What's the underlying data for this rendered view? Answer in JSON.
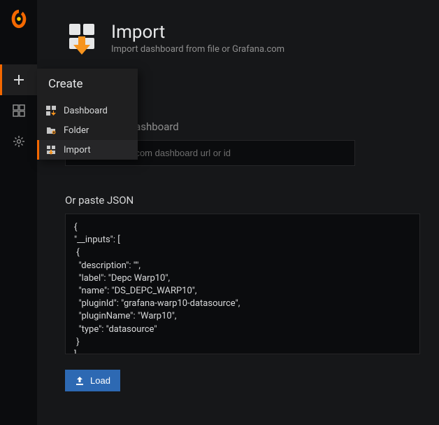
{
  "header": {
    "title": "Import",
    "subtitle": "Import dashboard from file or Grafana.com"
  },
  "flyout": {
    "title": "Create",
    "items": [
      {
        "label": "Dashboard"
      },
      {
        "label": "Folder"
      },
      {
        "label": "Import"
      }
    ]
  },
  "form": {
    "grafana_label": "Grafana.com Dashboard",
    "grafana_placeholder": "Paste Grafana.com dashboard url or id",
    "json_label": "Or paste JSON",
    "json_value": "{\n\"__inputs\": [\n {\n  \"description\": \"\",\n  \"label\": \"Depc Warp10\",\n  \"name\": \"DS_DEPC_WARP10\",\n  \"pluginId\": \"grafana-warp10-datasource\",\n  \"pluginName\": \"Warp10\",\n  \"type\": \"datasource\"\n }\n],",
    "load_label": "Load"
  }
}
